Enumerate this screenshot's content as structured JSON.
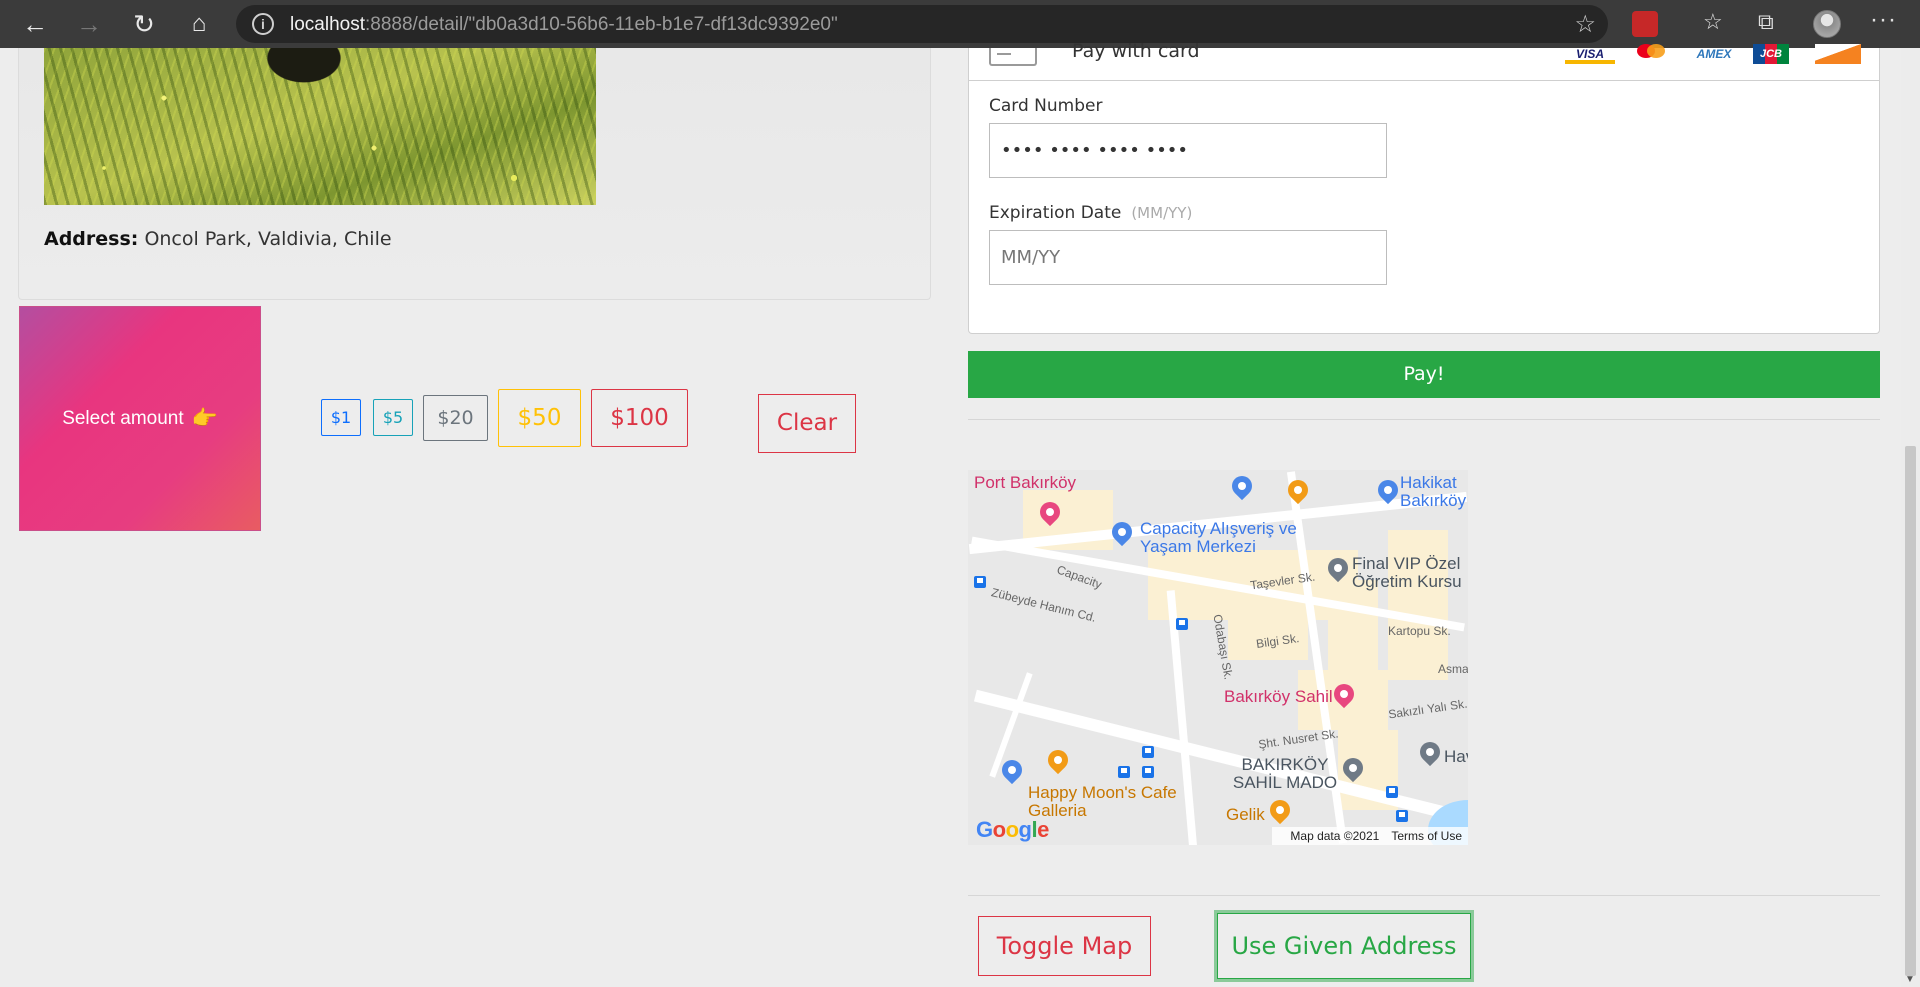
{
  "browser": {
    "url_host": "localhost",
    "url_rest": ":8888/detail/\"db0a3d10-56b6-11eb-b1e7-df13dc9392e0\""
  },
  "listing": {
    "address_label": "Address:",
    "address_value": "Oncol Park, Valdivia, Chile"
  },
  "donation": {
    "select_label": "Select amount",
    "amounts": [
      "$1",
      "$5",
      "$20",
      "$50",
      "$100"
    ],
    "clear_label": "Clear"
  },
  "payment": {
    "pay_with_label": "Pay with card",
    "card_brands": [
      "VISA",
      "mastercard",
      "AMEX",
      "JCB",
      "DISCOVER"
    ],
    "card_number_label": "Card Number",
    "card_number_value": "•••• •••• •••• ••••",
    "expiration_label": "Expiration Date",
    "expiration_hint": "(MM/YY)",
    "expiration_placeholder": "MM/YY",
    "pay_button": "Pay!"
  },
  "map": {
    "places": {
      "port": "Port Bakırköy",
      "hakikat": "Hakikat Bakırköy",
      "capacity": "Capacity Alışveriş ve Yaşam Merkezi",
      "final": "Final VIP Özel Öğretim Kursu",
      "sahil": "Bakırköy Sahil",
      "mado": "BAKIRKÖY SAHİL MADO",
      "happy": "Happy Moon's Cafe Galleria",
      "gelik": "Gelik",
      "hav": "Hav"
    },
    "streets": {
      "capacity": "Capacity",
      "zubeyde": "Zübeyde Hanım Cd.",
      "tasevler": "Taşevler Sk.",
      "bilgi": "Bilgi Sk.",
      "kartopu": "Kartopu Sk.",
      "odabasi": "Odabaşı Sk.",
      "asma": "Asma",
      "sakizli": "Sakızlı Yalı Sk.",
      "nusret": "Şht. Nusret Sk."
    },
    "attribution": "Map data ©2021",
    "terms": "Terms of Use",
    "google": "Google"
  },
  "actions": {
    "toggle_map": "Toggle Map",
    "use_address": "Use Given Address"
  },
  "colors": {
    "success": "#28a745",
    "danger": "#dc3545",
    "warning": "#ffc107",
    "primary": "#0d6efd",
    "info": "#17a2b8",
    "secondary": "#6c757d"
  }
}
